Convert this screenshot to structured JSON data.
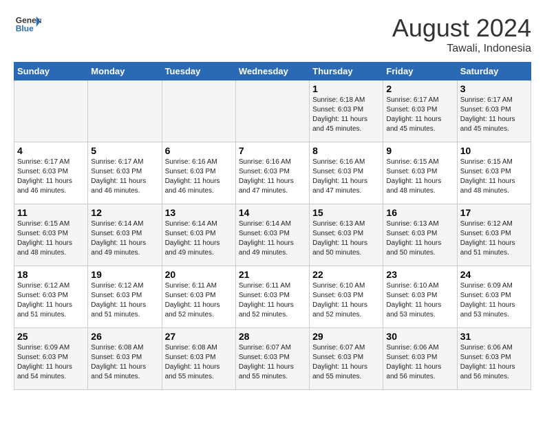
{
  "header": {
    "logo_line1": "General",
    "logo_line2": "Blue",
    "month_year": "August 2024",
    "location": "Tawali, Indonesia"
  },
  "weekdays": [
    "Sunday",
    "Monday",
    "Tuesday",
    "Wednesday",
    "Thursday",
    "Friday",
    "Saturday"
  ],
  "weeks": [
    [
      {
        "day": "",
        "sunrise": "",
        "sunset": "",
        "daylight": ""
      },
      {
        "day": "",
        "sunrise": "",
        "sunset": "",
        "daylight": ""
      },
      {
        "day": "",
        "sunrise": "",
        "sunset": "",
        "daylight": ""
      },
      {
        "day": "",
        "sunrise": "",
        "sunset": "",
        "daylight": ""
      },
      {
        "day": "1",
        "sunrise": "Sunrise: 6:18 AM",
        "sunset": "Sunset: 6:03 PM",
        "daylight": "Daylight: 11 hours and 45 minutes."
      },
      {
        "day": "2",
        "sunrise": "Sunrise: 6:17 AM",
        "sunset": "Sunset: 6:03 PM",
        "daylight": "Daylight: 11 hours and 45 minutes."
      },
      {
        "day": "3",
        "sunrise": "Sunrise: 6:17 AM",
        "sunset": "Sunset: 6:03 PM",
        "daylight": "Daylight: 11 hours and 45 minutes."
      }
    ],
    [
      {
        "day": "4",
        "sunrise": "Sunrise: 6:17 AM",
        "sunset": "Sunset: 6:03 PM",
        "daylight": "Daylight: 11 hours and 46 minutes."
      },
      {
        "day": "5",
        "sunrise": "Sunrise: 6:17 AM",
        "sunset": "Sunset: 6:03 PM",
        "daylight": "Daylight: 11 hours and 46 minutes."
      },
      {
        "day": "6",
        "sunrise": "Sunrise: 6:16 AM",
        "sunset": "Sunset: 6:03 PM",
        "daylight": "Daylight: 11 hours and 46 minutes."
      },
      {
        "day": "7",
        "sunrise": "Sunrise: 6:16 AM",
        "sunset": "Sunset: 6:03 PM",
        "daylight": "Daylight: 11 hours and 47 minutes."
      },
      {
        "day": "8",
        "sunrise": "Sunrise: 6:16 AM",
        "sunset": "Sunset: 6:03 PM",
        "daylight": "Daylight: 11 hours and 47 minutes."
      },
      {
        "day": "9",
        "sunrise": "Sunrise: 6:15 AM",
        "sunset": "Sunset: 6:03 PM",
        "daylight": "Daylight: 11 hours and 48 minutes."
      },
      {
        "day": "10",
        "sunrise": "Sunrise: 6:15 AM",
        "sunset": "Sunset: 6:03 PM",
        "daylight": "Daylight: 11 hours and 48 minutes."
      }
    ],
    [
      {
        "day": "11",
        "sunrise": "Sunrise: 6:15 AM",
        "sunset": "Sunset: 6:03 PM",
        "daylight": "Daylight: 11 hours and 48 minutes."
      },
      {
        "day": "12",
        "sunrise": "Sunrise: 6:14 AM",
        "sunset": "Sunset: 6:03 PM",
        "daylight": "Daylight: 11 hours and 49 minutes."
      },
      {
        "day": "13",
        "sunrise": "Sunrise: 6:14 AM",
        "sunset": "Sunset: 6:03 PM",
        "daylight": "Daylight: 11 hours and 49 minutes."
      },
      {
        "day": "14",
        "sunrise": "Sunrise: 6:14 AM",
        "sunset": "Sunset: 6:03 PM",
        "daylight": "Daylight: 11 hours and 49 minutes."
      },
      {
        "day": "15",
        "sunrise": "Sunrise: 6:13 AM",
        "sunset": "Sunset: 6:03 PM",
        "daylight": "Daylight: 11 hours and 50 minutes."
      },
      {
        "day": "16",
        "sunrise": "Sunrise: 6:13 AM",
        "sunset": "Sunset: 6:03 PM",
        "daylight": "Daylight: 11 hours and 50 minutes."
      },
      {
        "day": "17",
        "sunrise": "Sunrise: 6:12 AM",
        "sunset": "Sunset: 6:03 PM",
        "daylight": "Daylight: 11 hours and 51 minutes."
      }
    ],
    [
      {
        "day": "18",
        "sunrise": "Sunrise: 6:12 AM",
        "sunset": "Sunset: 6:03 PM",
        "daylight": "Daylight: 11 hours and 51 minutes."
      },
      {
        "day": "19",
        "sunrise": "Sunrise: 6:12 AM",
        "sunset": "Sunset: 6:03 PM",
        "daylight": "Daylight: 11 hours and 51 minutes."
      },
      {
        "day": "20",
        "sunrise": "Sunrise: 6:11 AM",
        "sunset": "Sunset: 6:03 PM",
        "daylight": "Daylight: 11 hours and 52 minutes."
      },
      {
        "day": "21",
        "sunrise": "Sunrise: 6:11 AM",
        "sunset": "Sunset: 6:03 PM",
        "daylight": "Daylight: 11 hours and 52 minutes."
      },
      {
        "day": "22",
        "sunrise": "Sunrise: 6:10 AM",
        "sunset": "Sunset: 6:03 PM",
        "daylight": "Daylight: 11 hours and 52 minutes."
      },
      {
        "day": "23",
        "sunrise": "Sunrise: 6:10 AM",
        "sunset": "Sunset: 6:03 PM",
        "daylight": "Daylight: 11 hours and 53 minutes."
      },
      {
        "day": "24",
        "sunrise": "Sunrise: 6:09 AM",
        "sunset": "Sunset: 6:03 PM",
        "daylight": "Daylight: 11 hours and 53 minutes."
      }
    ],
    [
      {
        "day": "25",
        "sunrise": "Sunrise: 6:09 AM",
        "sunset": "Sunset: 6:03 PM",
        "daylight": "Daylight: 11 hours and 54 minutes."
      },
      {
        "day": "26",
        "sunrise": "Sunrise: 6:08 AM",
        "sunset": "Sunset: 6:03 PM",
        "daylight": "Daylight: 11 hours and 54 minutes."
      },
      {
        "day": "27",
        "sunrise": "Sunrise: 6:08 AM",
        "sunset": "Sunset: 6:03 PM",
        "daylight": "Daylight: 11 hours and 55 minutes."
      },
      {
        "day": "28",
        "sunrise": "Sunrise: 6:07 AM",
        "sunset": "Sunset: 6:03 PM",
        "daylight": "Daylight: 11 hours and 55 minutes."
      },
      {
        "day": "29",
        "sunrise": "Sunrise: 6:07 AM",
        "sunset": "Sunset: 6:03 PM",
        "daylight": "Daylight: 11 hours and 55 minutes."
      },
      {
        "day": "30",
        "sunrise": "Sunrise: 6:06 AM",
        "sunset": "Sunset: 6:03 PM",
        "daylight": "Daylight: 11 hours and 56 minutes."
      },
      {
        "day": "31",
        "sunrise": "Sunrise: 6:06 AM",
        "sunset": "Sunset: 6:03 PM",
        "daylight": "Daylight: 11 hours and 56 minutes."
      }
    ]
  ]
}
